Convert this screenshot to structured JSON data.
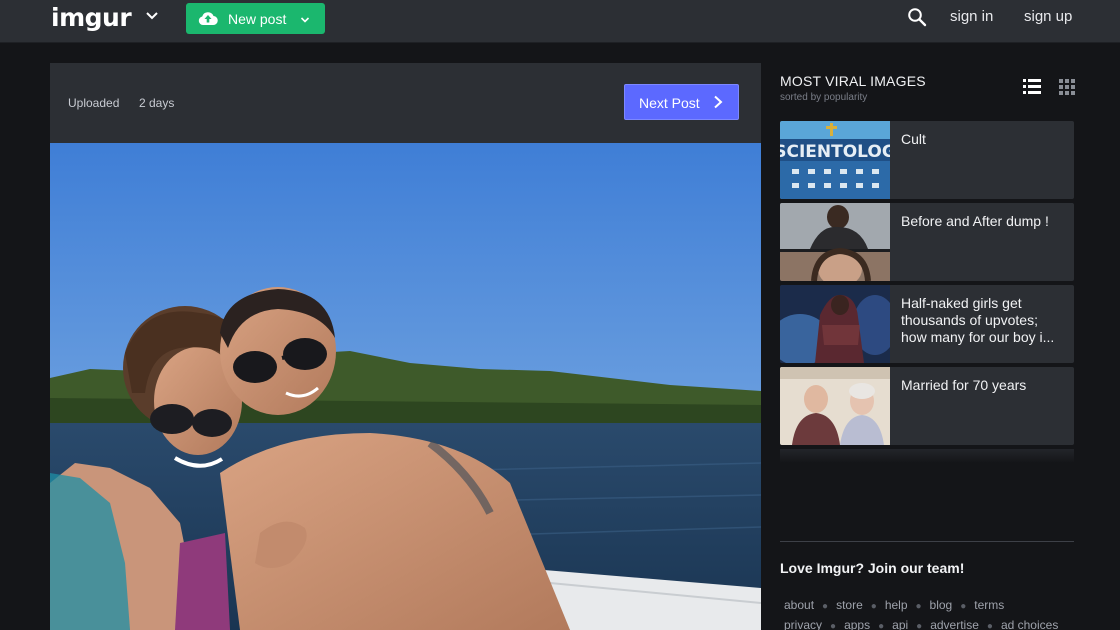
{
  "header": {
    "logo": "imgur",
    "new_post_label": "New post",
    "sign_in": "sign in",
    "sign_up": "sign up"
  },
  "post": {
    "uploaded_label": "Uploaded",
    "uploaded_value": "2 days",
    "next_post_label": "Next Post"
  },
  "sidebar": {
    "title": "MOST VIRAL IMAGES",
    "subtitle": "sorted by popularity",
    "thumb_sign_text": "SCIENTOLOG",
    "items": [
      {
        "title": "Cult"
      },
      {
        "title": "Before and After dump !"
      },
      {
        "title": "Half-naked girls get thousands of upvotes; how many for our boy i..."
      },
      {
        "title": "Married for 70 years"
      }
    ],
    "join_text": "Love Imgur? Join our team!",
    "footer_row1": [
      "about",
      "store",
      "help",
      "blog",
      "terms"
    ],
    "footer_row2": [
      "privacy",
      "apps",
      "api",
      "advertise",
      "ad choices"
    ]
  },
  "colors": {
    "page_bg": "#141518",
    "panel_bg": "#2c2f34",
    "new_post_green": "#1bb76e",
    "next_post_blue": "#5c69ff"
  },
  "icons": [
    "chevron-down-icon",
    "cloud-upload-icon",
    "search-icon",
    "chevron-right-icon",
    "list-view-icon",
    "grid-view-icon"
  ]
}
